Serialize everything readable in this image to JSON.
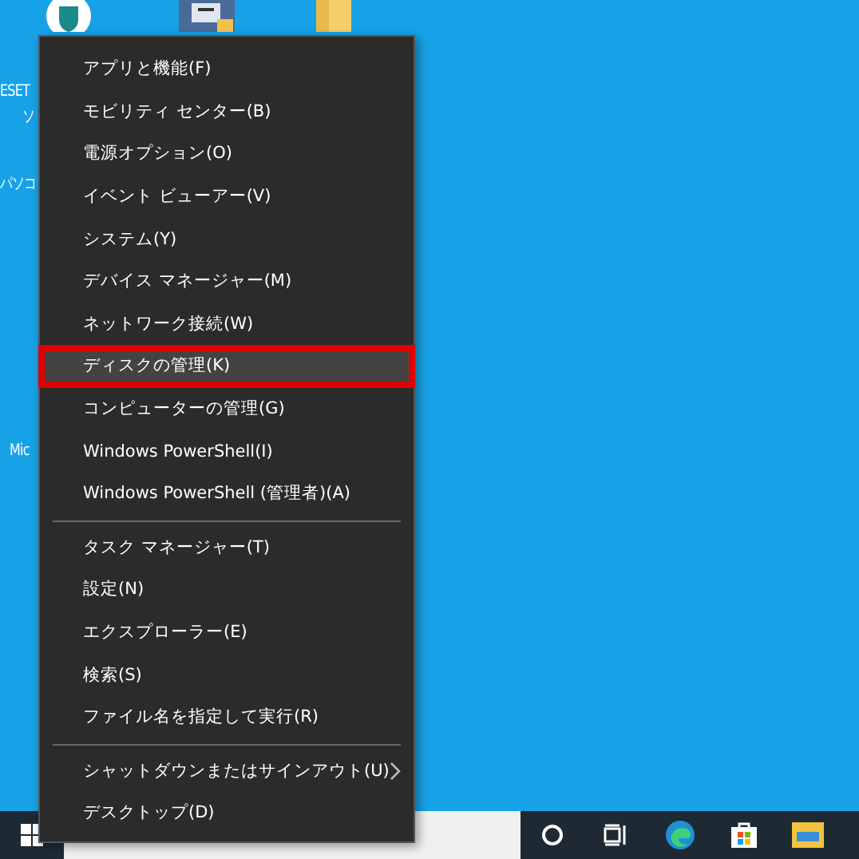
{
  "desktop_labels": [
    "ESET",
    "ソ",
    "パソコ",
    "Mic"
  ],
  "menu": {
    "items": [
      {
        "label": "アプリと機能(F)",
        "selected": false,
        "submenu": false,
        "separator_before": false
      },
      {
        "label": "モビリティ センター(B)",
        "selected": false,
        "submenu": false,
        "separator_before": false
      },
      {
        "label": "電源オプション(O)",
        "selected": false,
        "submenu": false,
        "separator_before": false
      },
      {
        "label": "イベント ビューアー(V)",
        "selected": false,
        "submenu": false,
        "separator_before": false
      },
      {
        "label": "システム(Y)",
        "selected": false,
        "submenu": false,
        "separator_before": false
      },
      {
        "label": "デバイス マネージャー(M)",
        "selected": false,
        "submenu": false,
        "separator_before": false
      },
      {
        "label": "ネットワーク接続(W)",
        "selected": false,
        "submenu": false,
        "separator_before": false
      },
      {
        "label": "ディスクの管理(K)",
        "selected": true,
        "submenu": false,
        "separator_before": false
      },
      {
        "label": "コンピューターの管理(G)",
        "selected": false,
        "submenu": false,
        "separator_before": false
      },
      {
        "label": "Windows PowerShell(I)",
        "selected": false,
        "submenu": false,
        "separator_before": false
      },
      {
        "label": "Windows PowerShell (管理者)(A)",
        "selected": false,
        "submenu": false,
        "separator_before": false
      },
      {
        "label": "タスク マネージャー(T)",
        "selected": false,
        "submenu": false,
        "separator_before": true
      },
      {
        "label": "設定(N)",
        "selected": false,
        "submenu": false,
        "separator_before": false
      },
      {
        "label": "エクスプローラー(E)",
        "selected": false,
        "submenu": false,
        "separator_before": false
      },
      {
        "label": "検索(S)",
        "selected": false,
        "submenu": false,
        "separator_before": false
      },
      {
        "label": "ファイル名を指定して実行(R)",
        "selected": false,
        "submenu": false,
        "separator_before": false
      },
      {
        "label": "シャットダウンまたはサインアウト(U)",
        "selected": false,
        "submenu": true,
        "separator_before": true
      },
      {
        "label": "デスクトップ(D)",
        "selected": false,
        "submenu": false,
        "separator_before": false
      }
    ]
  }
}
